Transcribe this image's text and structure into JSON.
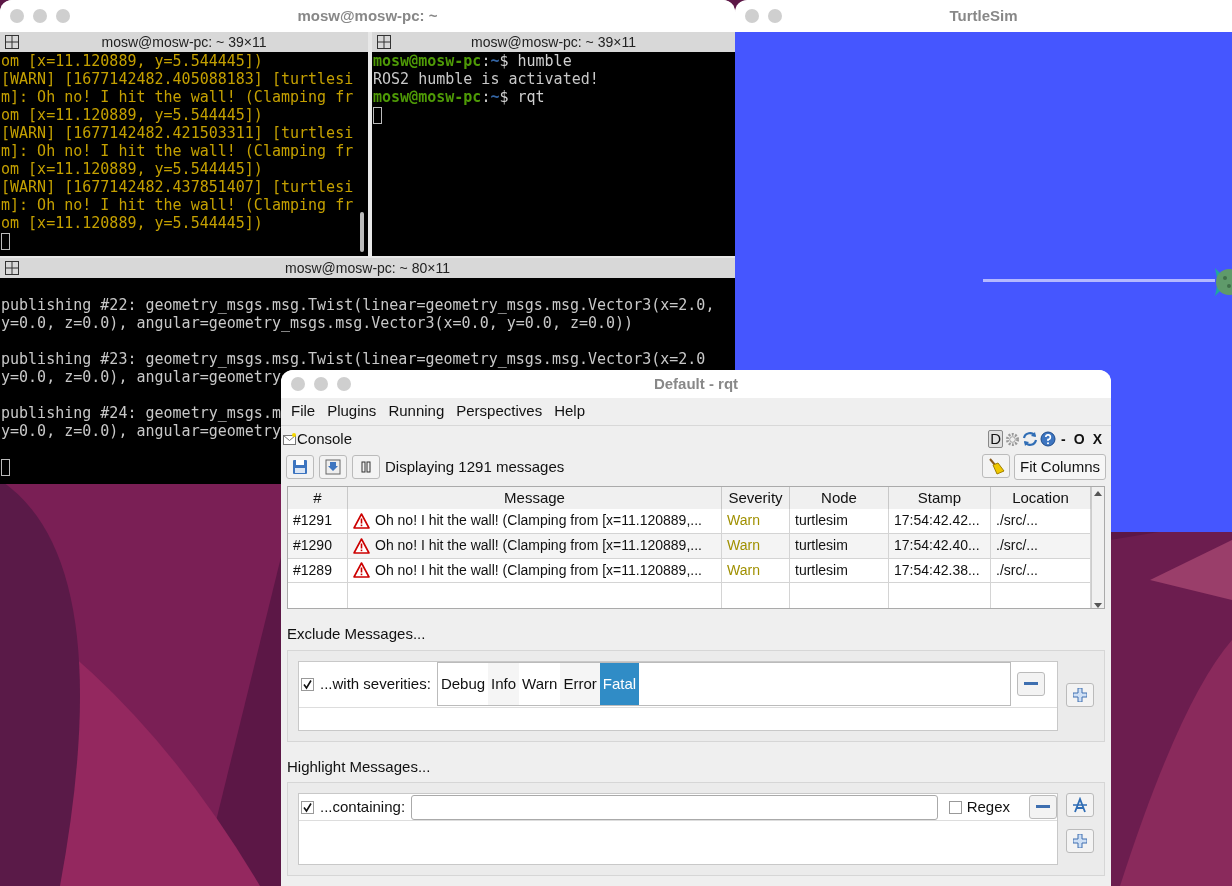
{
  "terminal": {
    "title": "mosw@mosw-pc: ~",
    "panes": [
      {
        "title": "mosw@mosw-pc: ~ 39×11",
        "lines": [
          {
            "kind": "warn",
            "text": "om [x=11.120889, y=5.544445])"
          },
          {
            "kind": "warn",
            "text": "[WARN] [1677142482.405088183] [turtlesi"
          },
          {
            "kind": "warn",
            "text": "m]: Oh no! I hit the wall! (Clamping fr"
          },
          {
            "kind": "warn",
            "text": "om [x=11.120889, y=5.544445])"
          },
          {
            "kind": "warn",
            "text": "[WARN] [1677142482.421503311] [turtlesi"
          },
          {
            "kind": "warn",
            "text": "m]: Oh no! I hit the wall! (Clamping fr"
          },
          {
            "kind": "warn",
            "text": "om [x=11.120889, y=5.544445])"
          },
          {
            "kind": "warn",
            "text": "[WARN] [1677142482.437851407] [turtlesi"
          },
          {
            "kind": "warn",
            "text": "m]: Oh no! I hit the wall! (Clamping fr"
          },
          {
            "kind": "warn",
            "text": "om [x=11.120889, y=5.544445])"
          },
          {
            "kind": "cursor"
          }
        ]
      },
      {
        "title": "mosw@mosw-pc: ~ 39×11",
        "lines": [
          {
            "kind": "prompt",
            "user": "mosw@mosw-pc",
            "sep": ":",
            "path": "~",
            "command": "$ humble"
          },
          {
            "kind": "output",
            "text": "ROS2 humble is activated!"
          },
          {
            "kind": "prompt",
            "user": "mosw@mosw-pc",
            "sep": ":",
            "path": "~",
            "command": "$ rqt"
          },
          {
            "kind": "cursor"
          }
        ]
      },
      {
        "title": "mosw@mosw-pc: ~ 80×11",
        "lines": [
          {
            "kind": "blank"
          },
          {
            "kind": "output",
            "text": "publishing #22: geometry_msgs.msg.Twist(linear=geometry_msgs.msg.Vector3(x=2.0,"
          },
          {
            "kind": "output",
            "text": "y=0.0, z=0.0), angular=geometry_msgs.msg.Vector3(x=0.0, y=0.0, z=0.0))"
          },
          {
            "kind": "blank"
          },
          {
            "kind": "output",
            "text": "publishing #23: geometry_msgs.msg.Twist(linear=geometry_msgs.msg.Vector3(x=2.0"
          },
          {
            "kind": "output",
            "text": "y=0.0, z=0.0), angular=geometry"
          },
          {
            "kind": "blank"
          },
          {
            "kind": "output",
            "text": "publishing #24: geometry_msgs.m"
          },
          {
            "kind": "output",
            "text": "y=0.0, z=0.0), angular=geometry"
          },
          {
            "kind": "blank"
          },
          {
            "kind": "cursor"
          }
        ]
      }
    ]
  },
  "turtlesim": {
    "title": "TurtleSim"
  },
  "rqt": {
    "title": "Default - rqt",
    "menu": [
      "File",
      "Plugins",
      "Running",
      "Perspectives",
      "Help"
    ],
    "plugin": {
      "title": "Console",
      "controls": [
        "D",
        "-",
        "O",
        "X"
      ]
    },
    "status": "Displaying 1291 messages",
    "fit_button": "Fit Columns",
    "table": {
      "columns": [
        "#",
        "Message",
        "Severity",
        "Node",
        "Stamp",
        "Location"
      ],
      "rows": [
        {
          "number": "#1291",
          "message": "Oh no! I hit the wall! (Clamping from [x=11.120889,...",
          "severity": "Warn",
          "node": "turtlesim",
          "stamp": "17:54:42.42...",
          "location": "./src/..."
        },
        {
          "number": "#1290",
          "message": "Oh no! I hit the wall! (Clamping from [x=11.120889,...",
          "severity": "Warn",
          "node": "turtlesim",
          "stamp": "17:54:42.40...",
          "location": "./src/..."
        },
        {
          "number": "#1289",
          "message": "Oh no! I hit the wall! (Clamping from [x=11.120889,...",
          "severity": "Warn",
          "node": "turtlesim",
          "stamp": "17:54:42.38...",
          "location": "./src/..."
        }
      ]
    },
    "exclude": {
      "label": "Exclude Messages...",
      "filter": {
        "checked": true,
        "label": "...with severities:",
        "options": [
          {
            "label": "Debug",
            "selected": false
          },
          {
            "label": "Info",
            "selected": false
          },
          {
            "label": "Warn",
            "selected": false
          },
          {
            "label": "Error",
            "selected": false
          },
          {
            "label": "Fatal",
            "selected": true
          }
        ]
      }
    },
    "highlight": {
      "label": "Highlight Messages...",
      "filter": {
        "checked": true,
        "label": "...containing:",
        "regex": {
          "label": "Regex",
          "checked": false
        }
      }
    }
  }
}
